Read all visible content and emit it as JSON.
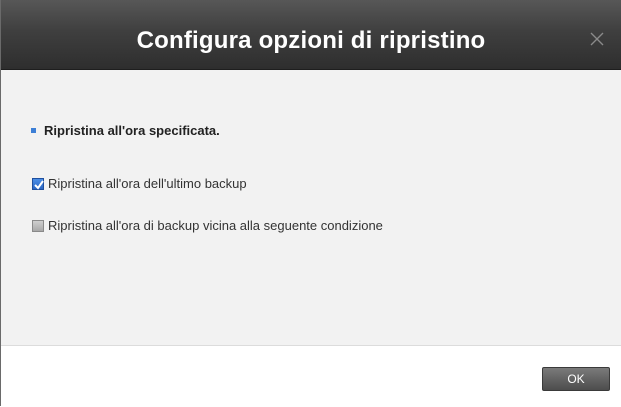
{
  "dialog": {
    "title": "Configura opzioni di ripristino",
    "close_icon": "close-icon"
  },
  "content": {
    "heading": "Ripristina all'ora specificata.",
    "options": [
      {
        "label": "Ripristina all'ora dell'ultimo backup",
        "checked": true
      },
      {
        "label": "Ripristina all'ora di backup vicina alla seguente condizione",
        "checked": false
      }
    ]
  },
  "footer": {
    "ok_label": "OK"
  },
  "colors": {
    "accent": "#3d7fd6",
    "titlebar": "#3f3f3f"
  }
}
